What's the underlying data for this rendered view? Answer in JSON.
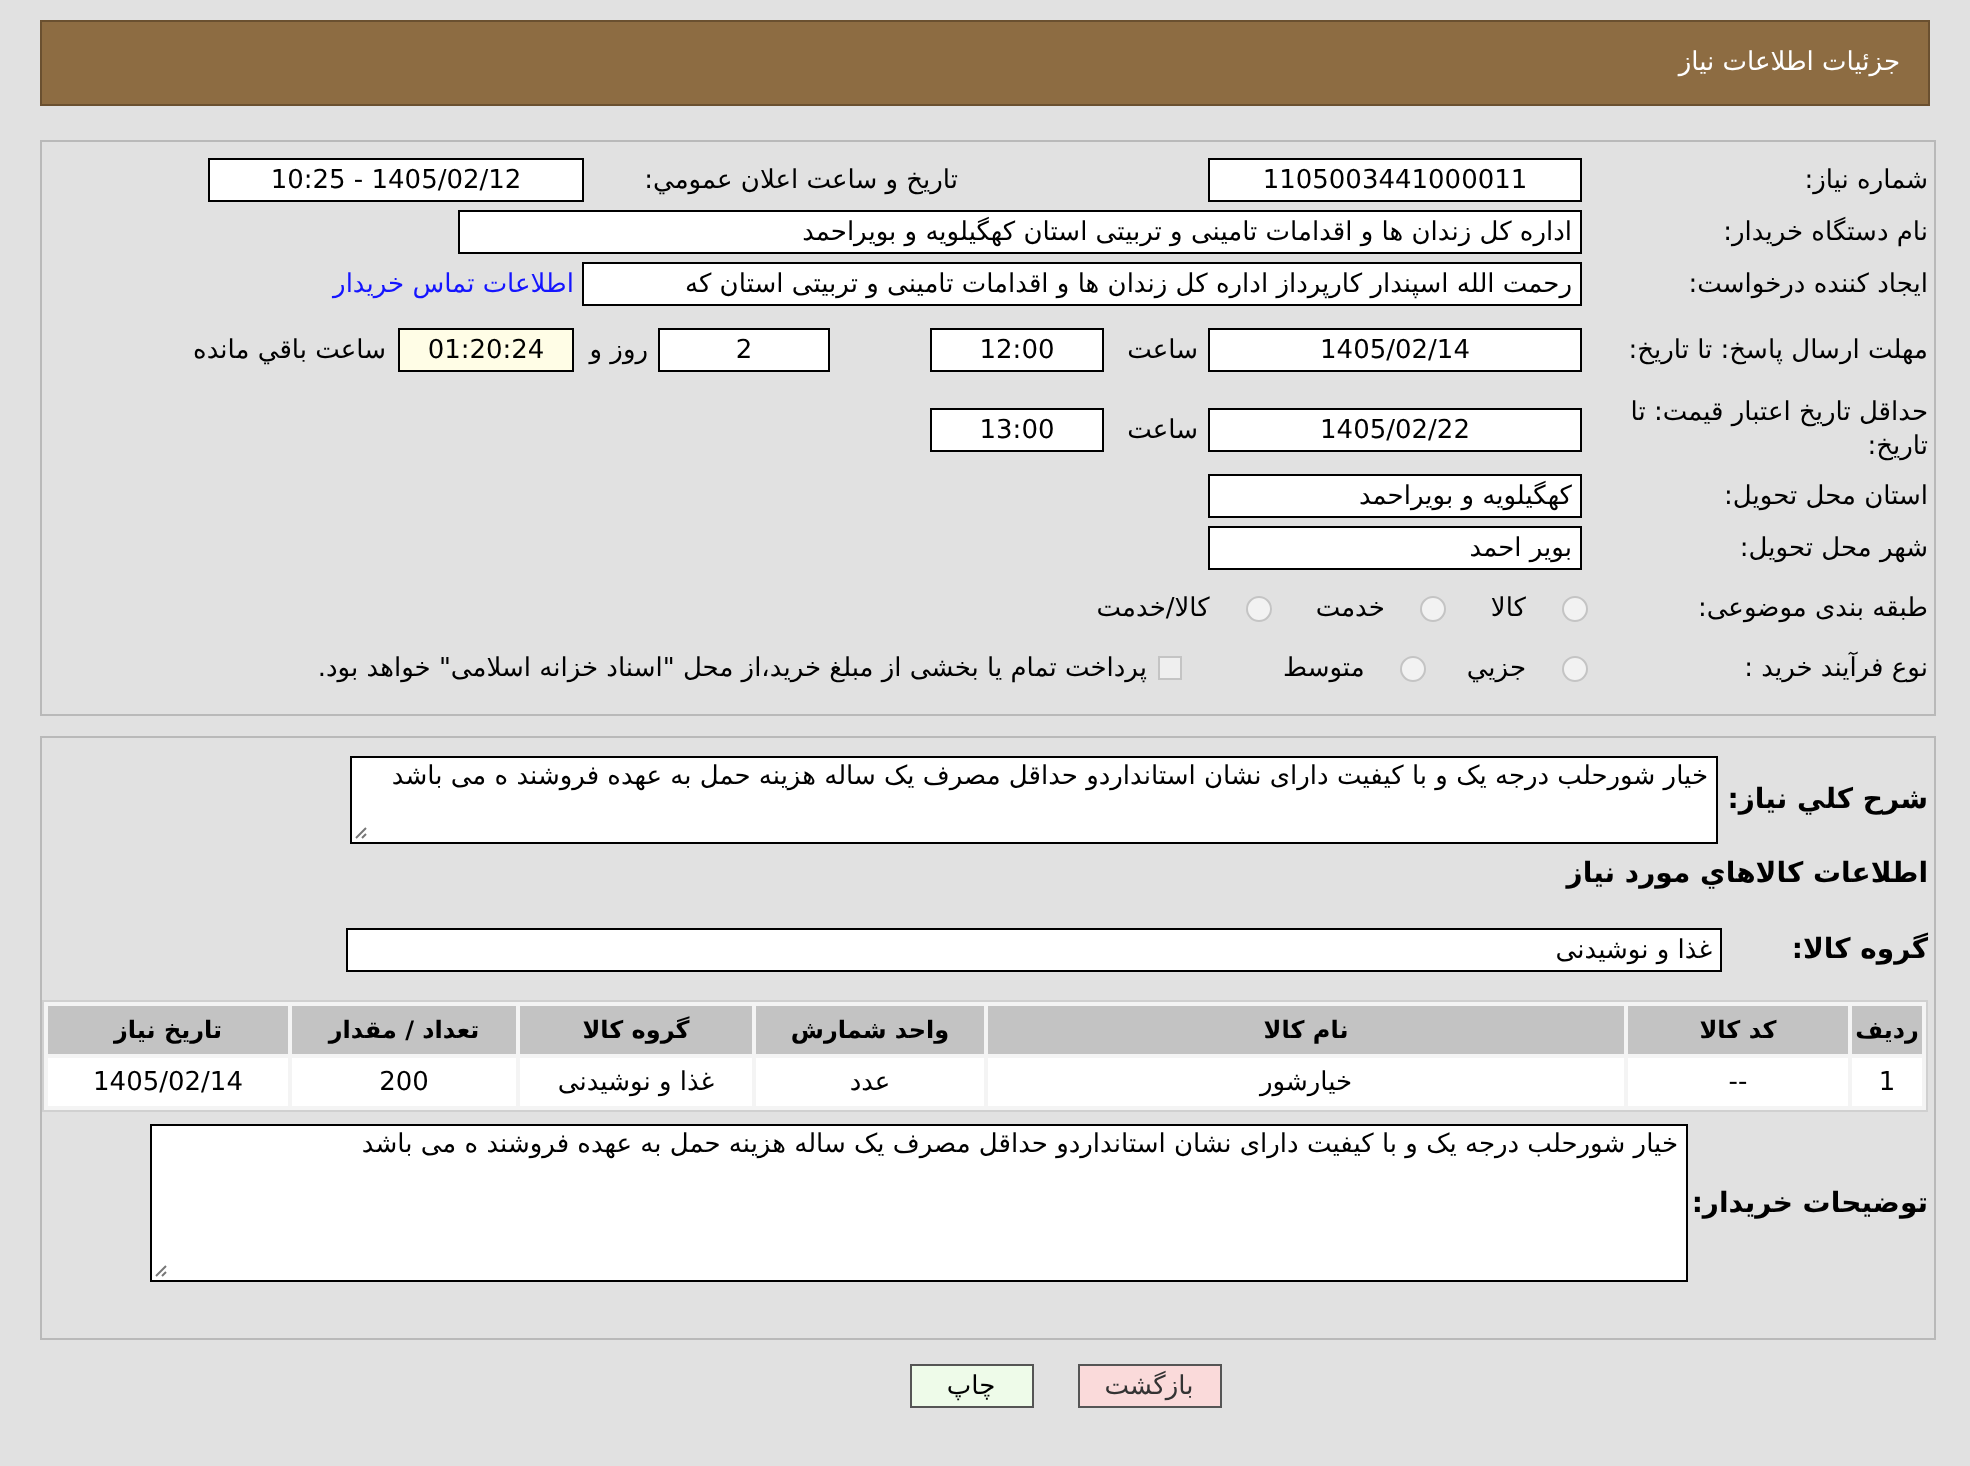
{
  "header": {
    "title": "جزئیات اطلاعات نیاز"
  },
  "details": {
    "need_number": {
      "label": "شماره نیاز:",
      "value": "1105003441000011"
    },
    "announce": {
      "label": "تاریخ و ساعت اعلان عمومي:",
      "value": "1405/02/12 - 10:25"
    },
    "buyer_org": {
      "label": "نام دستگاه خریدار:",
      "value": "اداره کل زندان ها و اقدامات تامینی و تربیتی استان کهگیلویه و بویراحمد"
    },
    "creator": {
      "label": "ایجاد کننده درخواست:",
      "value": "رحمت الله اسپندار کارپرداز اداره کل زندان ها و اقدامات تامینی و تربیتی استان که",
      "link": "اطلاعات تماس خریدار"
    },
    "reply_deadline": {
      "label": "مهلت ارسال پاسخ: تا تاریخ:",
      "date": "1405/02/14",
      "time_label": "ساعت",
      "time": "12:00",
      "days": "2",
      "days_label": "روز و",
      "remaining": "01:20:24",
      "remaining_label": "ساعت باقي مانده"
    },
    "price_validity": {
      "label": "حداقل تاریخ اعتبار قیمت: تا تاریخ:",
      "date": "1405/02/22",
      "time_label": "ساعت",
      "time": "13:00"
    },
    "province": {
      "label": "استان محل تحویل:",
      "value": "کهگیلویه و بویراحمد"
    },
    "city": {
      "label": "شهر محل تحویل:",
      "value": "بویر احمد"
    },
    "category": {
      "label": "طبقه بندی موضوعی:",
      "options": [
        {
          "label": "کالا",
          "selected": false
        },
        {
          "label": "خدمت",
          "selected": false
        },
        {
          "label": "کالا/خدمت",
          "selected": false
        }
      ]
    },
    "purchase_type": {
      "label": "نوع فرآیند خرید :",
      "options": [
        {
          "label": "جزيي",
          "selected": false
        },
        {
          "label": "متوسط",
          "selected": false
        }
      ],
      "treasury_note": {
        "checked": false,
        "text": "پرداخت تمام یا بخشی از مبلغ خرید،از محل \"اسناد خزانه اسلامی\" خواهد بود."
      }
    }
  },
  "description": {
    "label": "شرح کلي نیاز:",
    "value": "خیار شورحلب درجه یک و با کیفیت دارای نشان استانداردو حداقل مصرف یک ساله هزینه حمل به عهده فروشند ه می باشد"
  },
  "goods": {
    "title": "اطلاعات کالاهاي مورد نیاز",
    "group_label": "گروه کالا:",
    "group_value": "غذا و نوشیدنی",
    "table": {
      "columns": [
        "ردیف",
        "کد کالا",
        "نام کالا",
        "واحد شمارش",
        "گروه کالا",
        "تعداد / مقدار",
        "تاریخ نیاز"
      ],
      "rows": [
        [
          "1",
          "--",
          "خیارشور",
          "عدد",
          "غذا و نوشیدنی",
          "200",
          "1405/02/14"
        ]
      ]
    }
  },
  "buyer_notes": {
    "label": "توضیحات خریدار:",
    "value": "خیار شورحلب درجه یک و با کیفیت دارای نشان استانداردو حداقل مصرف یک ساله هزینه حمل به عهده فروشند ه می باشد"
  },
  "buttons": [
    {
      "label": "بازگشت",
      "kind": "back"
    },
    {
      "label": "چاپ",
      "kind": "print"
    }
  ]
}
